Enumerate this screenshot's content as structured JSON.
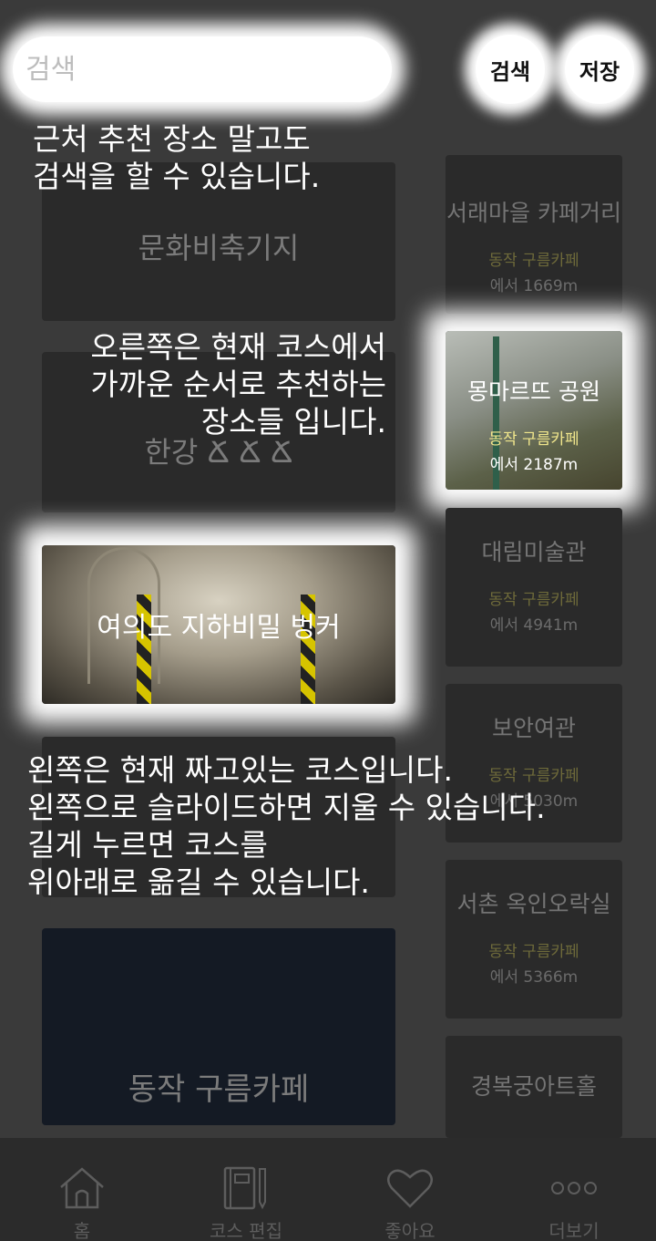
{
  "search": {
    "placeholder": "검색"
  },
  "header": {
    "search_label": "검색",
    "save_label": "저장"
  },
  "course": {
    "items": [
      {
        "title": "문화비축기지"
      },
      {
        "title": "한강 Ճ Ճ Ճ"
      },
      {
        "title": "여의도 지하비밀 벙커"
      },
      {
        "title": ""
      },
      {
        "title": "동작 구름카페"
      }
    ]
  },
  "recommend": {
    "items": [
      {
        "title": "서래마을 카페거리",
        "sub": "동작 구름카페",
        "dist": "에서 1669m"
      },
      {
        "title": "몽마르뜨 공원",
        "sub": "동작 구름카페",
        "dist": "에서 2187m"
      },
      {
        "title": "대림미술관",
        "sub": "동작 구름카페",
        "dist": "에서 4941m"
      },
      {
        "title": "보안여관",
        "sub": "동작 구름카페",
        "dist": "에서 5030m"
      },
      {
        "title": "서촌 옥인오락실",
        "sub": "동작 구름카페",
        "dist": "에서 5366m"
      },
      {
        "title": "경복궁아트홀",
        "sub": "",
        "dist": ""
      }
    ]
  },
  "tips": {
    "search_line1": "근처 추천 장소 말고도",
    "search_line2": "검색을 할 수 있습니다.",
    "right_line1": "오른쪽은 현재 코스에서",
    "right_line2": "가까운 순서로 추천하는",
    "right_line3": "장소들 입니다.",
    "left_line1": "왼쪽은 현재 짜고있는 코스입니다.",
    "left_line2": "왼쪽으로 슬라이드하면 지울 수 있습니다.",
    "left_line3": "길게 누르면 코스를",
    "left_line4": "위아래로 옮길 수 있습니다."
  },
  "nav": {
    "home": "홈",
    "course_edit": "코스 편집",
    "likes": "좋아요",
    "more": "더보기"
  }
}
